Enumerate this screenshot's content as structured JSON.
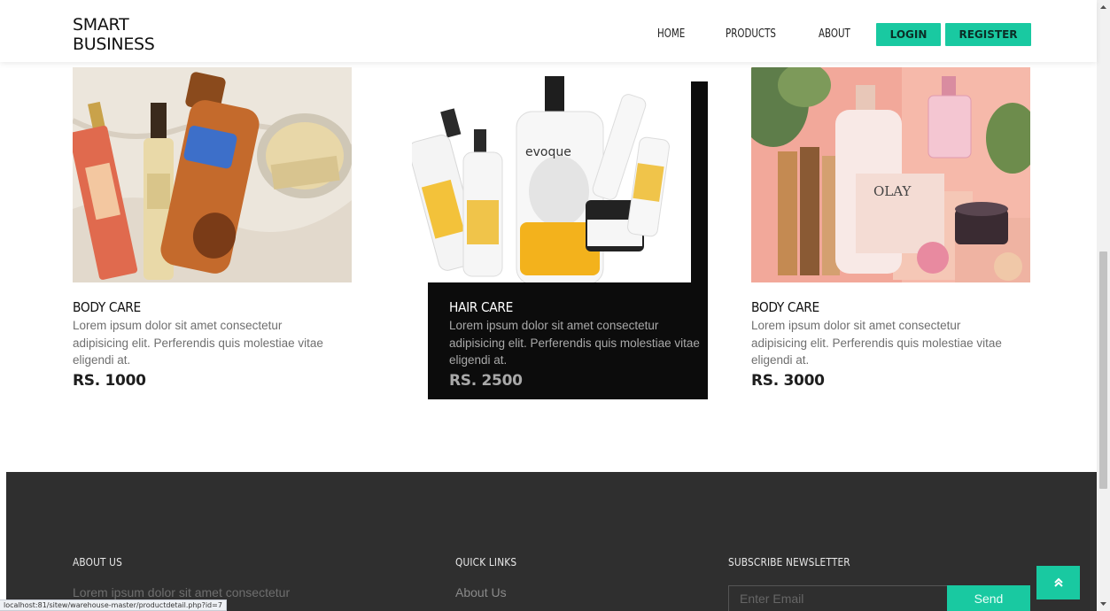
{
  "header": {
    "logo_line1": "SMART",
    "logo_line2": "BUSINESS",
    "nav": [
      "HOME",
      "PRODUCTS",
      "ABOUT"
    ],
    "login_label": "LOGIN",
    "register_label": "REGISTER"
  },
  "products": [
    {
      "title": "BODY CARE",
      "description": "Lorem ipsum dolor sit amet consectetur adipisicing elit. Perferendis quis molestiae vitae eligendi at.",
      "price": "RS. 1000"
    },
    {
      "title": "HAIR CARE",
      "description": "Lorem ipsum dolor sit amet consectetur adipisicing elit. Perferendis quis molestiae vitae eligendi at.",
      "price": "RS. 2500",
      "hovered": true
    },
    {
      "title": "BODY CARE",
      "description": "Lorem ipsum dolor sit amet consectetur adipisicing elit. Perferendis quis molestiae vitae eligendi at.",
      "price": "RS. 3000"
    }
  ],
  "footer": {
    "about_heading": "ABOUT US",
    "about_text": "Lorem ipsum dolor sit amet consectetur",
    "links_heading": "QUICK LINKS",
    "links": [
      "About Us"
    ],
    "newsletter_heading": "SUBSCRIBE NEWSLETTER",
    "email_placeholder": "Enter Email",
    "send_label": "Send"
  },
  "scroll_top_icon": "double-chevron-up-icon",
  "status_bar": "localhost:81/sitew/warehouse-master/productdetail.php?id=7",
  "colors": {
    "accent": "#19c9a1",
    "footer_bg": "#2f2f2f",
    "hover_card_bg": "#0c0c0c"
  }
}
